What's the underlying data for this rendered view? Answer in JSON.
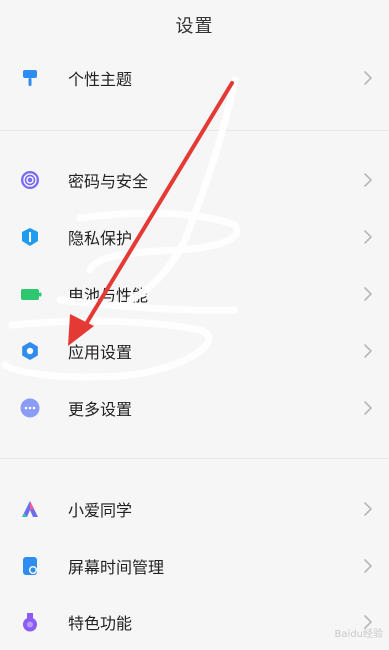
{
  "header": {
    "title": "设置"
  },
  "sections": [
    {
      "items": [
        {
          "key": "theme",
          "label": "个性主题",
          "icon": "paintbrush-icon",
          "color": "#2f8cf0"
        }
      ]
    },
    {
      "items": [
        {
          "key": "security",
          "label": "密码与安全",
          "icon": "fingerprint-icon",
          "color": "#7a6cf0"
        },
        {
          "key": "privacy",
          "label": "隐私保护",
          "icon": "shield-icon",
          "color": "#1f9bef"
        },
        {
          "key": "battery",
          "label": "电池与性能",
          "icon": "battery-icon",
          "color": "#2ec66e"
        },
        {
          "key": "apps",
          "label": "应用设置",
          "icon": "gear-icon",
          "color": "#2f8cf0"
        },
        {
          "key": "more",
          "label": "更多设置",
          "icon": "more-dots-icon",
          "color": "#8a9cf5"
        }
      ]
    },
    {
      "items": [
        {
          "key": "xiaoai",
          "label": "小爱同学",
          "icon": "xiaoai-icon",
          "color": "#6b6cf6"
        },
        {
          "key": "screentime",
          "label": "屏幕时间管理",
          "icon": "hourglass-icon",
          "color": "#2f8cf0"
        },
        {
          "key": "features",
          "label": "特色功能",
          "icon": "flask-icon",
          "color": "#8b5cf6"
        }
      ]
    }
  ],
  "annotation": {
    "arrow_color": "#e53935",
    "scribble_color": "#ffffff"
  },
  "watermark": {
    "text": "Baidu经验"
  }
}
